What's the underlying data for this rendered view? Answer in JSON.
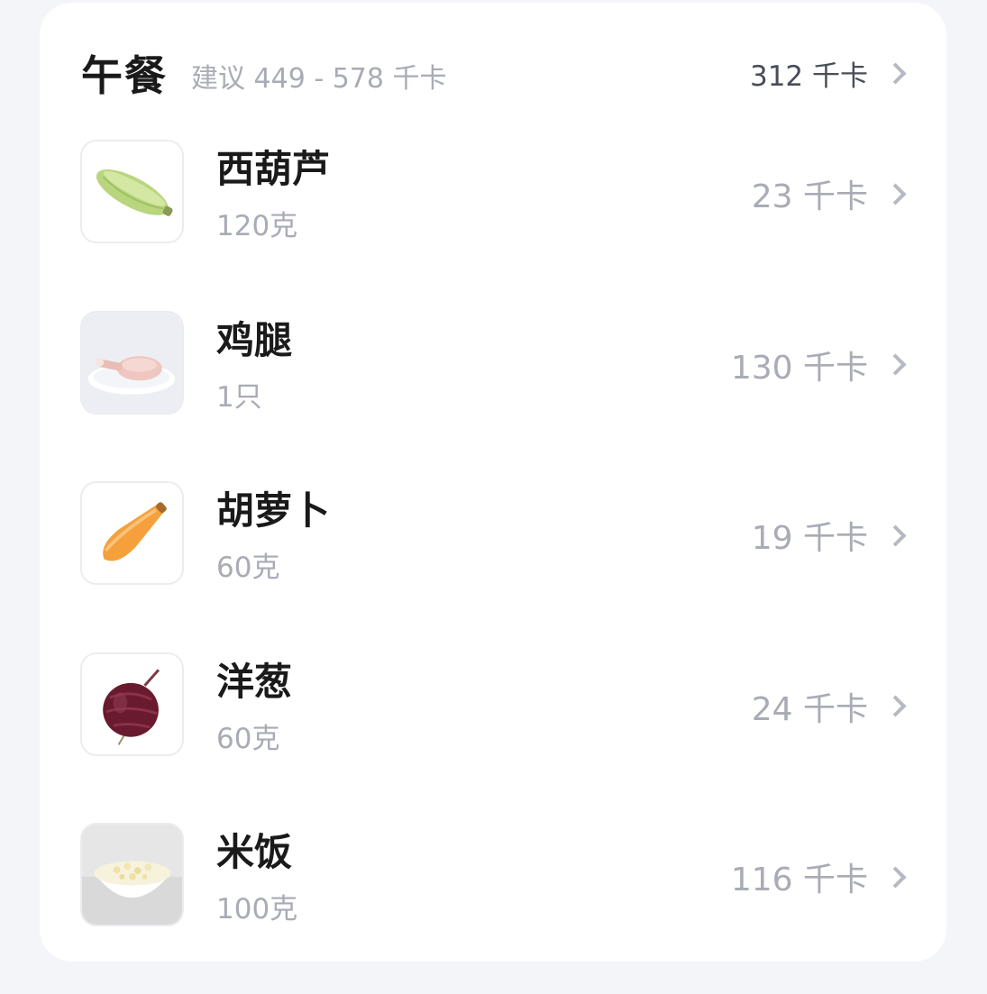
{
  "meal": {
    "title": "午餐",
    "suggestion": "建议 449 - 578 千卡",
    "total": "312 千卡"
  },
  "foods": [
    {
      "name": "西葫芦",
      "amount": "120克",
      "kcal": "23 千卡",
      "icon": "zucchini-icon"
    },
    {
      "name": "鸡腿",
      "amount": "1只",
      "kcal": "130 千卡",
      "icon": "chicken-leg-icon"
    },
    {
      "name": "胡萝卜",
      "amount": "60克",
      "kcal": "19 千卡",
      "icon": "carrot-icon"
    },
    {
      "name": "洋葱",
      "amount": "60克",
      "kcal": "24 千卡",
      "icon": "onion-icon"
    },
    {
      "name": "米饭",
      "amount": "100克",
      "kcal": "116 千卡",
      "icon": "rice-bowl-icon"
    }
  ]
}
